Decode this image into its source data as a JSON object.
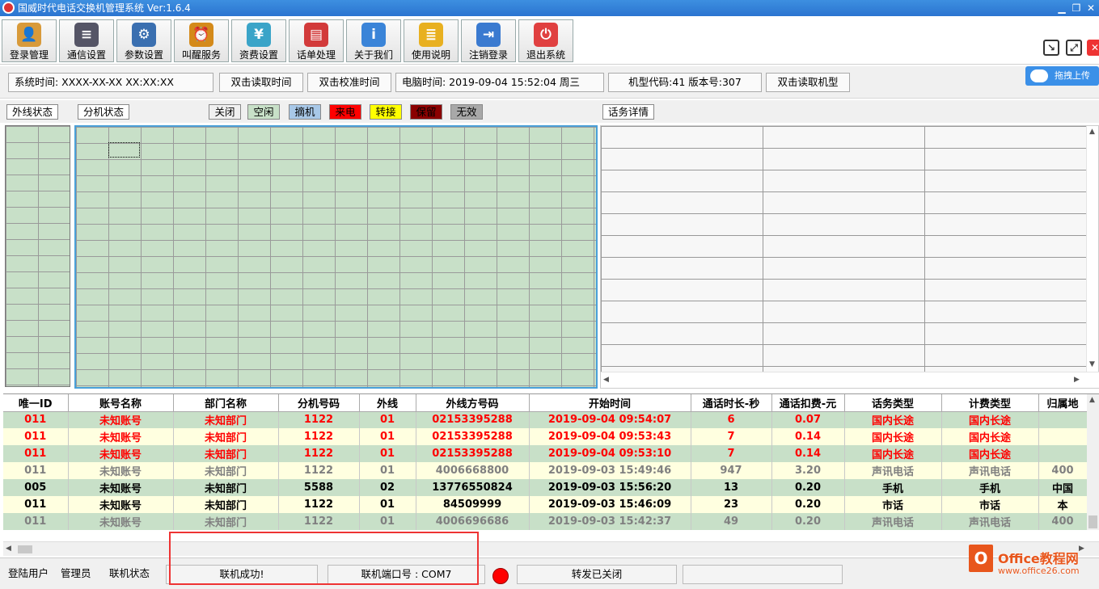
{
  "window": {
    "title": "国威时代电话交换机管理系统 Ver:1.6.4",
    "min": "▁",
    "restore": "❐",
    "close": "✕"
  },
  "toolbar": [
    {
      "label": "登录管理",
      "icon": "user-icon",
      "glyph": "👤",
      "color": "#d89a3a"
    },
    {
      "label": "通信设置",
      "icon": "sliders-icon",
      "glyph": "≡",
      "color": "#556"
    },
    {
      "label": "参数设置",
      "icon": "monitor-gear-icon",
      "glyph": "⚙",
      "color": "#3a6fb0"
    },
    {
      "label": "叫醒服务",
      "icon": "alarm-clock-icon",
      "glyph": "⏰",
      "color": "#d48a1a"
    },
    {
      "label": "资费设置",
      "icon": "money-card-icon",
      "glyph": "¥",
      "color": "#3aa4c8"
    },
    {
      "label": "话单处理",
      "icon": "bill-stack-icon",
      "glyph": "▤",
      "color": "#d23a3a"
    },
    {
      "label": "关于我们",
      "icon": "info-icon",
      "glyph": "i",
      "color": "#3a84d8"
    },
    {
      "label": "使用说明",
      "icon": "document-icon",
      "glyph": "≣",
      "color": "#e8b020"
    },
    {
      "label": "注销登录",
      "icon": "logout-icon",
      "glyph": "⇥",
      "color": "#3a7ad0"
    },
    {
      "label": "退出系统",
      "icon": "power-icon",
      "glyph": "⏻",
      "color": "#e04040"
    }
  ],
  "right_tools": {
    "shrink": "↘",
    "expand": "⤢",
    "close": "✕"
  },
  "info": {
    "system_time": "系统时间: XXXX-XX-XX XX:XX:XX",
    "read_time_btn": "双击读取时间",
    "calibrate_btn": "双击校准时间",
    "pc_time": "电脑时间: 2019-09-04 15:52:04 周三",
    "model": "机型代码:41 版本号:307",
    "read_model_btn": "双击读取机型",
    "upload": "拖拽上传"
  },
  "status": {
    "trunk_tab": "外线状态",
    "ext_tab": "分机状态",
    "detail_tab": "话务详情",
    "legend": [
      {
        "label": "关闭",
        "bg": "#f0f0f0",
        "fg": "#000"
      },
      {
        "label": "空闲",
        "bg": "#c8e0c8",
        "fg": "#000"
      },
      {
        "label": "摘机",
        "bg": "#a8c8e8",
        "fg": "#000"
      },
      {
        "label": "来电",
        "bg": "#ff0000",
        "fg": "#000"
      },
      {
        "label": "转接",
        "bg": "#ffff00",
        "fg": "#000"
      },
      {
        "label": "保留",
        "bg": "#8b0000",
        "fg": "#000"
      },
      {
        "label": "无效",
        "bg": "#a8a8a8",
        "fg": "#000"
      }
    ]
  },
  "records": {
    "columns": [
      "唯一ID",
      "账号名称",
      "部门名称",
      "分机号码",
      "外线",
      "外线方号码",
      "开始时间",
      "通话时长-秒",
      "通话扣费-元",
      "话务类型",
      "计费类型",
      "归属地"
    ],
    "rows": [
      {
        "style": "red",
        "bg": "#c8e0c8",
        "cells": [
          "011",
          "未知账号",
          "未知部门",
          "1122",
          "01",
          "02153395288",
          "2019-09-04 09:54:07",
          "6",
          "0.07",
          "国内长途",
          "国内长途",
          ""
        ]
      },
      {
        "style": "red",
        "bg": "#ffffe0",
        "cells": [
          "011",
          "未知账号",
          "未知部门",
          "1122",
          "01",
          "02153395288",
          "2019-09-04 09:53:43",
          "7",
          "0.14",
          "国内长途",
          "国内长途",
          ""
        ]
      },
      {
        "style": "red",
        "bg": "#c8e0c8",
        "cells": [
          "011",
          "未知账号",
          "未知部门",
          "1122",
          "01",
          "02153395288",
          "2019-09-04 09:53:10",
          "7",
          "0.14",
          "国内长途",
          "国内长途",
          ""
        ]
      },
      {
        "style": "gray",
        "bg": "#ffffe0",
        "cells": [
          "011",
          "未知账号",
          "未知部门",
          "1122",
          "01",
          "4006668800",
          "2019-09-03 15:49:46",
          "947",
          "3.20",
          "声讯电话",
          "声讯电话",
          "400"
        ]
      },
      {
        "style": "black",
        "bg": "#c8e0c8",
        "cells": [
          "005",
          "未知账号",
          "未知部门",
          "5588",
          "02",
          "13776550824",
          "2019-09-03 15:56:20",
          "13",
          "0.20",
          "手机",
          "手机",
          "中国"
        ]
      },
      {
        "style": "black",
        "bg": "#ffffe0",
        "cells": [
          "011",
          "未知账号",
          "未知部门",
          "1122",
          "01",
          "84509999",
          "2019-09-03 15:46:09",
          "23",
          "0.20",
          "市话",
          "市话",
          "本"
        ]
      },
      {
        "style": "gray",
        "bg": "#c8e0c8",
        "cells": [
          "011",
          "未知账号",
          "未知部门",
          "1122",
          "01",
          "4006696686",
          "2019-09-03 15:42:37",
          "49",
          "0.20",
          "声讯电话",
          "声讯电话",
          "400"
        ]
      }
    ]
  },
  "statusbar": {
    "login_user": "登陆用户",
    "admin": "管理员",
    "conn_state": "联机状态",
    "conn_success": "联机成功!",
    "port": "联机端口号 : COM7",
    "forward": "转发已关闭"
  },
  "watermark": {
    "brand": "Office教程网",
    "url": "www.office26.com"
  }
}
